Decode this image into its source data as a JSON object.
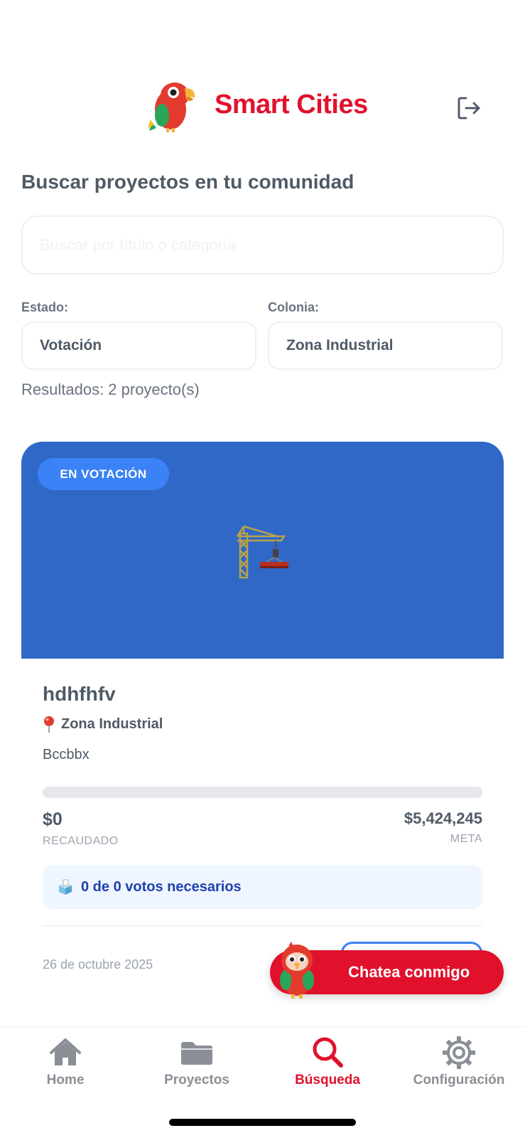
{
  "header": {
    "brand": "Smart Cities",
    "logo_icon": "parrot-logo-icon",
    "logout_icon": "logout-icon"
  },
  "page_title": "Buscar proyectos en tu comunidad",
  "search": {
    "placeholder": "Buscar por título o categoría",
    "value": ""
  },
  "filters": {
    "estado_label": "Estado:",
    "estado_value": "Votación",
    "colonia_label": "Colonia:",
    "colonia_value": "Zona Industrial"
  },
  "results_text": "Resultados: 2 proyecto(s)",
  "project": {
    "badge": "EN VOTACIÓN",
    "hero_icon": "construction-crane-icon",
    "title": "hdhfhfv",
    "location": "Zona Industrial",
    "description": "Bccbbx",
    "progress_fraction": 0,
    "raised_value": "$0",
    "raised_label": "RECAUDADO",
    "goal_value": "$5,424,245",
    "goal_label": "META",
    "votes_text": "0 de 0 votos necesarios",
    "date": "26 de octubre 2025"
  },
  "chat": {
    "label": "Chatea conmigo"
  },
  "tabs": [
    {
      "label": "Home",
      "icon": "home-icon",
      "active": false
    },
    {
      "label": "Proyectos",
      "icon": "folder-icon",
      "active": false
    },
    {
      "label": "Búsqueda",
      "icon": "search-icon",
      "active": true
    },
    {
      "label": "Configuración",
      "icon": "gear-icon",
      "active": false
    }
  ],
  "colors": {
    "brand_red": "#e1112c",
    "hero_blue": "#3068c8",
    "badge_blue": "#3b82f6",
    "votes_text_blue": "#1e40af"
  }
}
